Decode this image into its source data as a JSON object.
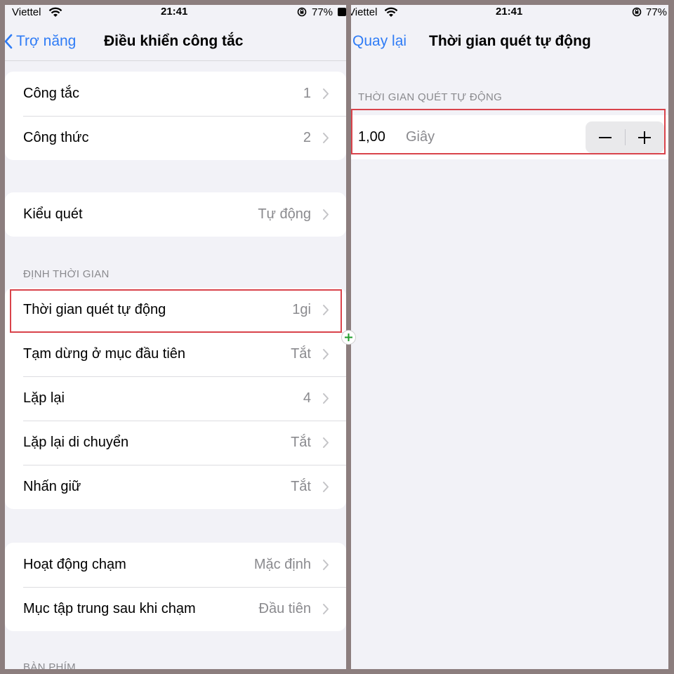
{
  "left": {
    "status": {
      "carrier": "Viettel",
      "time": "21:41",
      "battery": "77%"
    },
    "nav": {
      "back_label": "Trợ năng",
      "title": "Điều khiển công tắc"
    },
    "group1": [
      {
        "label": "Công tắc",
        "value": "1"
      },
      {
        "label": "Công thức",
        "value": "2"
      }
    ],
    "group2": [
      {
        "label": "Kiểu quét",
        "value": "Tự động"
      }
    ],
    "timing_header": "ĐỊNH THỜI GIAN",
    "group3": [
      {
        "label": "Thời gian quét tự động",
        "value": "1gi"
      },
      {
        "label": "Tạm dừng ở mục đầu tiên",
        "value": "Tắt"
      },
      {
        "label": "Lặp lại",
        "value": "4"
      },
      {
        "label": "Lặp lại di chuyển",
        "value": "Tắt"
      },
      {
        "label": "Nhấn giữ",
        "value": "Tắt"
      }
    ],
    "group4": [
      {
        "label": "Hoạt động chạm",
        "value": "Mặc định"
      },
      {
        "label": "Mục tập trung sau khi chạm",
        "value": "Đầu tiên"
      }
    ],
    "keyboard_header": "BÀN PHÍM"
  },
  "right": {
    "status": {
      "carrier": "Viettel",
      "time": "21:41",
      "battery": "77%"
    },
    "nav": {
      "back_label": "Quay lại",
      "title": "Thời gian quét tự động"
    },
    "section_header": "THỜI GIAN QUÉT TỰ ĐỘNG",
    "stepper": {
      "value": "1,00",
      "unit": "Giây"
    }
  },
  "colors": {
    "accent": "#2f7cf6",
    "highlight": "#d9434b",
    "background": "#f2f2f7"
  },
  "icons": [
    "wifi-icon",
    "rotation-lock-icon",
    "battery-icon",
    "chevron-left-icon",
    "chevron-right-icon",
    "minus-icon",
    "plus-icon",
    "split-plus-icon"
  ]
}
